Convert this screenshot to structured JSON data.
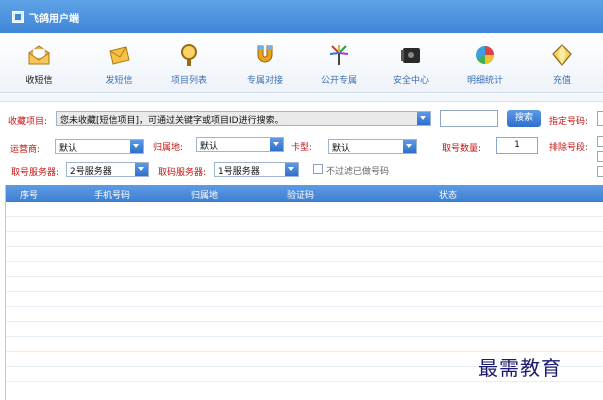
{
  "window": {
    "title": "飞鸽用户端"
  },
  "toolbar": {
    "items": [
      {
        "label": "收短信",
        "icon": "envelope-open-icon"
      },
      {
        "label": "发短信",
        "icon": "envelope-send-icon"
      },
      {
        "label": "项目列表",
        "icon": "magnifier-icon"
      },
      {
        "label": "专属对接",
        "icon": "magnet-icon"
      },
      {
        "label": "公开专属",
        "icon": "fireworks-icon"
      },
      {
        "label": "安全中心",
        "icon": "safe-icon"
      },
      {
        "label": "明细统计",
        "icon": "pie-chart-icon"
      },
      {
        "label": "充值",
        "icon": "diamond-icon"
      }
    ]
  },
  "form": {
    "project_label": "收藏项目:",
    "project_value": "您未收藏[短信项目]，可通过关键字或项目ID进行搜索。",
    "search_value": "",
    "search_button": "搜索",
    "designate_label": "指定号码:",
    "carrier_label": "运营商:",
    "carrier_value": "默认",
    "region_label": "归属地:",
    "region_value": "默认",
    "card_label": "卡型:",
    "card_value": "默认",
    "count_label": "取号数量:",
    "count_value": "1",
    "exclude_label": "排除号段:",
    "server1_label": "取号服务器:",
    "server1_value": "2号服务器",
    "server2_label": "取码服务器:",
    "server2_value": "1号服务器",
    "filter_label": "不过滤已做号码"
  },
  "table": {
    "columns": [
      "序号",
      "手机号码",
      "归属地",
      "验证码",
      "状态"
    ]
  },
  "watermark": "最需教育",
  "colors": {
    "accent": "#3f86d8",
    "label_red": "#c31616",
    "link_blue": "#3a6fb6"
  }
}
